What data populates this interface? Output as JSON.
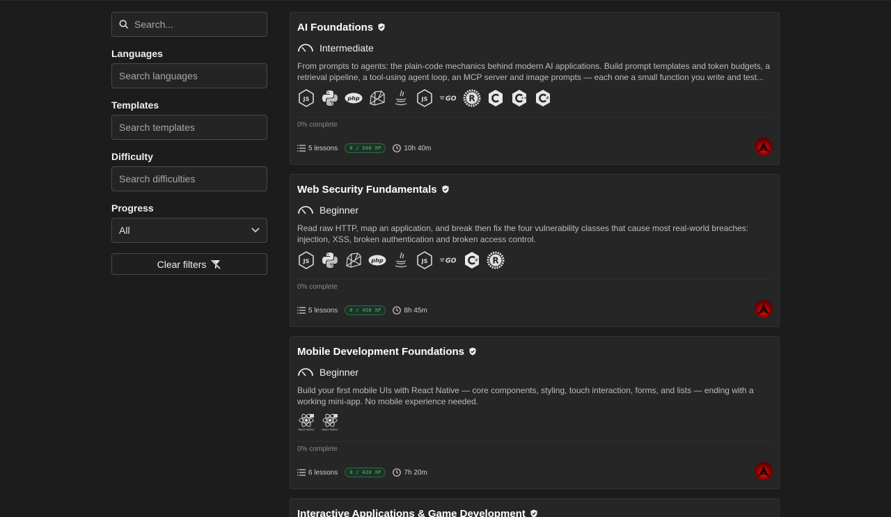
{
  "sidebar": {
    "search_placeholder": "Search...",
    "languages": {
      "label": "Languages",
      "placeholder": "Search languages"
    },
    "templates": {
      "label": "Templates",
      "placeholder": "Search templates"
    },
    "difficulty": {
      "label": "Difficulty",
      "placeholder": "Search difficulties"
    },
    "progress": {
      "label": "Progress",
      "selected": "All"
    },
    "clear_label": "Clear filters"
  },
  "courses": [
    {
      "title": "AI Foundations",
      "difficulty": "Intermediate",
      "description": "From prompts to agents: the plain-code mechanics behind modern AI applications. Build prompt templates and token budgets, a retrieval pipeline, a tool-using agent loop, an MCP server and image prompts — each one a small function you write and test...",
      "languages": [
        "javascript-icon",
        "python-icon",
        "php-icon",
        "ruby-icon",
        "java-icon",
        "typescript-icon",
        "go-icon",
        "rust-icon",
        "c-icon",
        "cpp-icon",
        "csharp-icon"
      ],
      "progress": "0% complete",
      "lessons": "5 lessons",
      "xp": "0 / 500 XP",
      "duration": "10h 40m"
    },
    {
      "title": "Web Security Fundamentals",
      "difficulty": "Beginner",
      "description": "Read raw HTTP, map an application, and break then fix the four vulnerability classes that cause most real-world breaches: injection, XSS, broken authentication and broken access control.",
      "languages": [
        "javascript-icon",
        "python-icon",
        "ruby-icon",
        "php-icon",
        "java-icon",
        "typescript-icon",
        "go-icon",
        "csharp-icon",
        "rust-icon"
      ],
      "progress": "0% complete",
      "lessons": "5 lessons",
      "xp": "0 / 450 XP",
      "duration": "8h 45m"
    },
    {
      "title": "Mobile Development Foundations",
      "difficulty": "Beginner",
      "description": "Build your first mobile UIs with React Native — core components, styling, touch interaction, forms, and lists — ending with a working mini-app. No mobile experience needed.",
      "languages": [
        "react-native-icon",
        "react-native-icon"
      ],
      "language_caption": "React Native",
      "progress": "0% complete",
      "lessons": "6 lessons",
      "xp": "0 / 420 XP",
      "duration": "7h 20m"
    },
    {
      "title": "Interactive Applications & Game Development"
    }
  ],
  "colors": {
    "background": "#1c1c1c",
    "card": "#262626",
    "xp_green": "#4fbf7d"
  }
}
